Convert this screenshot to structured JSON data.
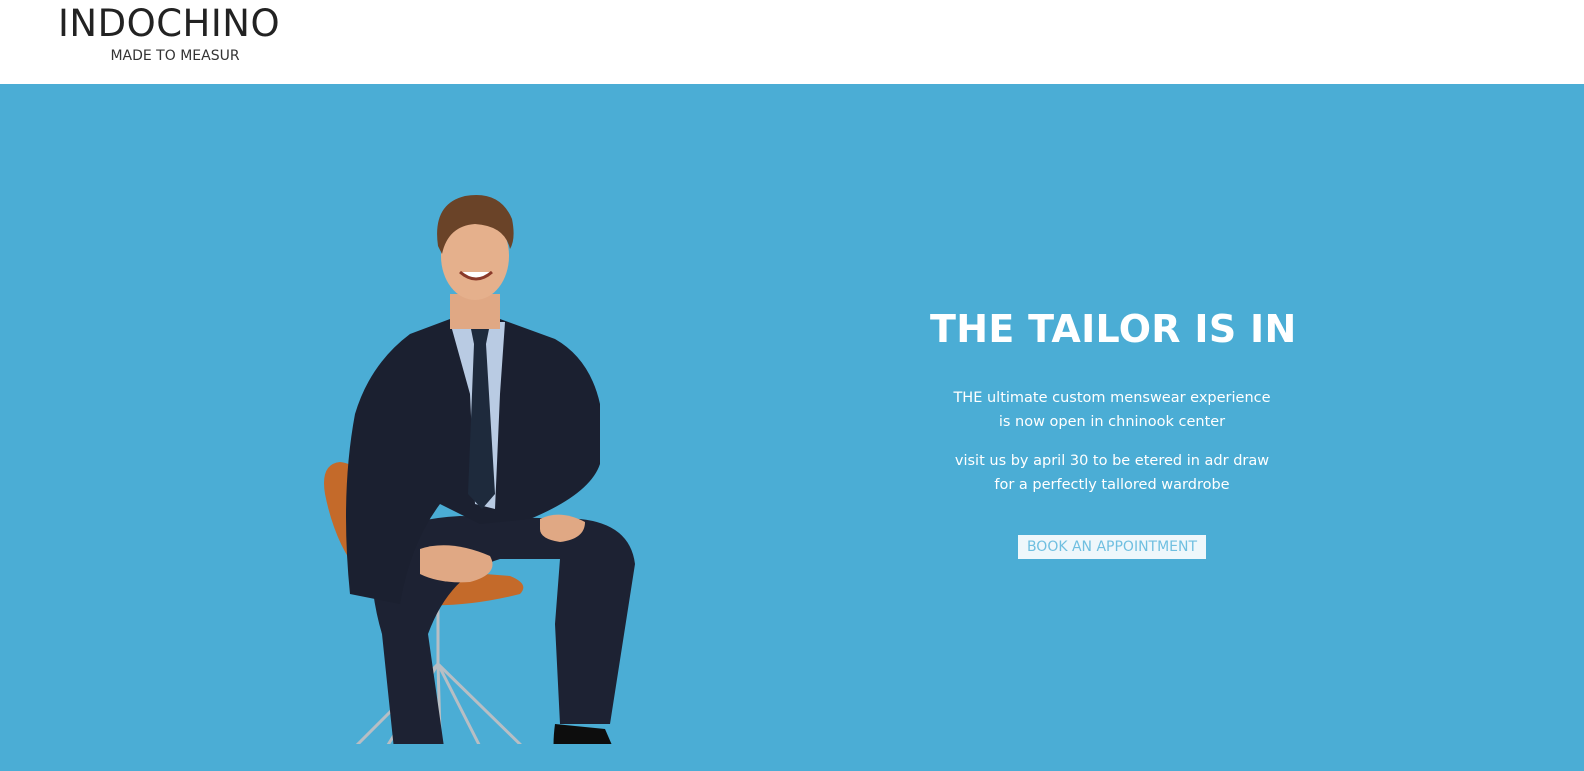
{
  "header": {
    "brand_name": "INDOCHINO",
    "brand_tagline": "MADE TO MEASUR"
  },
  "hero": {
    "background_color": "#4badd5",
    "headline": "THE TAILOR IS IN",
    "paragraph_1": {
      "line_1": "THE ultimate custom menswear experience",
      "line_2": "is now open in chninook center"
    },
    "paragraph_2": {
      "line_1": "visit us by april 30 to be etered in adr draw",
      "line_2": "for a perfectly tallored wardrobe"
    },
    "cta_label": "BOOK AN APPOINTMENT",
    "image": "man-in-suit-on-chair"
  }
}
